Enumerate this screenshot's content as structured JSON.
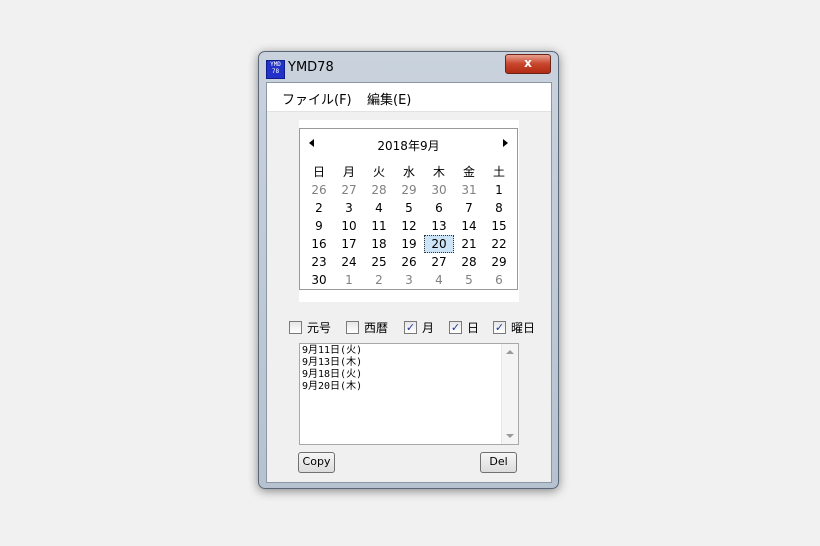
{
  "window": {
    "title": "YMD78",
    "icon_text": [
      "YMD",
      "78"
    ],
    "close_label": "x"
  },
  "menu": [
    {
      "label": "ファイル(F)"
    },
    {
      "label": "編集(E)"
    }
  ],
  "calendar": {
    "month_title": "2018年9月",
    "weekdays": [
      "日",
      "月",
      "火",
      "水",
      "木",
      "金",
      "土"
    ],
    "weeks": [
      [
        [
          "26",
          1
        ],
        [
          "27",
          1
        ],
        [
          "28",
          1
        ],
        [
          "29",
          1
        ],
        [
          "30",
          1
        ],
        [
          "31",
          1
        ],
        [
          "1",
          0
        ]
      ],
      [
        [
          "2",
          0
        ],
        [
          "3",
          0
        ],
        [
          "4",
          0
        ],
        [
          "5",
          0
        ],
        [
          "6",
          0
        ],
        [
          "7",
          0
        ],
        [
          "8",
          0
        ]
      ],
      [
        [
          "9",
          0
        ],
        [
          "10",
          0
        ],
        [
          "11",
          0
        ],
        [
          "12",
          0
        ],
        [
          "13",
          0
        ],
        [
          "14",
          0
        ],
        [
          "15",
          0
        ]
      ],
      [
        [
          "16",
          0
        ],
        [
          "17",
          0
        ],
        [
          "18",
          0
        ],
        [
          "19",
          0
        ],
        [
          "20",
          0
        ],
        [
          "21",
          0
        ],
        [
          "22",
          0
        ]
      ],
      [
        [
          "23",
          0
        ],
        [
          "24",
          0
        ],
        [
          "25",
          0
        ],
        [
          "26",
          0
        ],
        [
          "27",
          0
        ],
        [
          "28",
          0
        ],
        [
          "29",
          0
        ]
      ],
      [
        [
          "30",
          0
        ],
        [
          "1",
          1
        ],
        [
          "2",
          1
        ],
        [
          "3",
          1
        ],
        [
          "4",
          1
        ],
        [
          "5",
          1
        ],
        [
          "6",
          1
        ]
      ]
    ],
    "selected": "20"
  },
  "options": [
    {
      "label": "元号",
      "checked": false
    },
    {
      "label": "西暦",
      "checked": false
    },
    {
      "label": "月",
      "checked": true
    },
    {
      "label": "日",
      "checked": true
    },
    {
      "label": "曜日",
      "checked": true
    }
  ],
  "list_items": [
    "9月11日(火)",
    "9月13日(木)",
    "9月18日(火)",
    "9月20日(木)"
  ],
  "buttons": {
    "copy": "Copy",
    "del": "Del"
  }
}
